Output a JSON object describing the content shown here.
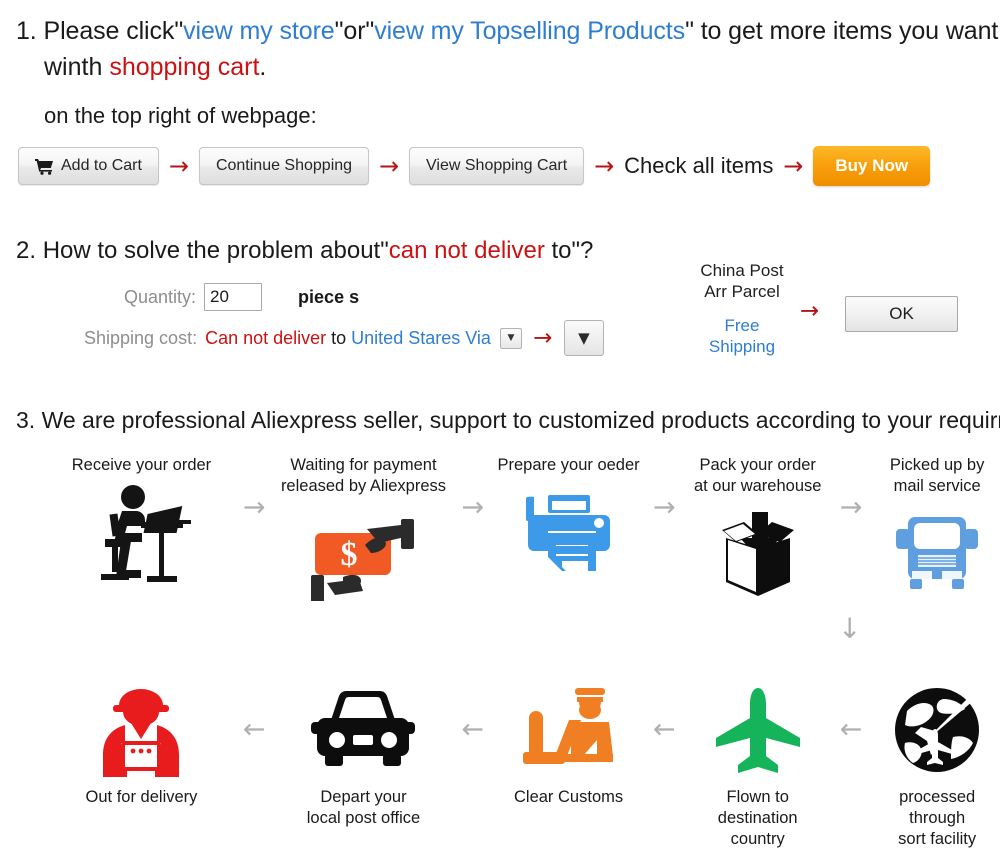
{
  "section1": {
    "number": "1.",
    "line1_a": "Please click",
    "line1_q1": "\"",
    "line1_link1": "view my store",
    "line1_q2": "\"or\"",
    "line1_link2": "view my Topselling Products",
    "line1_q3": "\"",
    "line1_b": " to get more items you want",
    "line2_a": "winth ",
    "line2_red": "shopping cart",
    "line2_b": ".",
    "subtitle": "on the top right of webpage:",
    "buttons": {
      "add_to_cart": "Add to Cart",
      "cart_icon": "shopping-cart-icon",
      "continue_shopping": "Continue Shopping",
      "view_shopping_cart": "View Shopping Cart",
      "check_all_items": "Check all items",
      "buy_now": "Buy Now"
    },
    "arrow": "→",
    "accent_red": "#b41414",
    "accent_orange": "#f89d09",
    "link_blue": "#2f7dd1"
  },
  "section2": {
    "number": "2.",
    "title_a": "How to solve the problem about",
    "title_q1": "\"",
    "title_red": "can not deliver",
    "title_b": " to",
    "title_q2": "\"?",
    "quantity_label": "Quantity:",
    "quantity_value": "20",
    "piece_label": "piece s",
    "shipping_label": "Shipping cost:",
    "shipping_red": "Can not deliver",
    "shipping_to": " to ",
    "shipping_blue": "United Stares Via",
    "dropdown_caret": "▼",
    "arrow": "→",
    "post_line1": "China Post",
    "post_line2": "Arr Parcel",
    "post_free1": "Free",
    "post_free2": "Shipping",
    "ok_label": "OK"
  },
  "section3": {
    "number": "3.",
    "title": "We are professional Aliexpress seller, support to customized products according to your requirment.",
    "arrow_h": "→",
    "arrow_l": "←",
    "arrow_d": "↓",
    "row1": [
      {
        "label": "Receive your order",
        "icon": "person-at-desk-icon",
        "color": "#141414"
      },
      {
        "label": "Waiting for payment\nreleased by Aliexpress",
        "icon": "cash-in-hand-icon",
        "color": "#f15a24"
      },
      {
        "label": "Prepare your oeder",
        "icon": "printer-icon",
        "color": "#3d9ae8"
      },
      {
        "label": "Pack your order\nat our warehouse",
        "icon": "box-packing-icon",
        "color": "#0d0d0d"
      },
      {
        "label": "Picked up by\nmail service",
        "icon": "truck-icon",
        "color": "#5f9fe0"
      }
    ],
    "row2": [
      {
        "label": "Out for delivery",
        "icon": "delivery-person-icon",
        "color": "#e81c1c"
      },
      {
        "label": "Depart your\nlocal post office",
        "icon": "car-icon",
        "color": "#0d0d0d"
      },
      {
        "label": "Clear Customs",
        "icon": "customs-officer-icon",
        "color": "#ef7f22"
      },
      {
        "label": "Flown to destination\ncountry",
        "icon": "airplane-icon",
        "color": "#16b45a"
      },
      {
        "label": "processed through\nsort facility",
        "icon": "globe-plane-icon",
        "color": "#0d0d0d"
      }
    ]
  }
}
